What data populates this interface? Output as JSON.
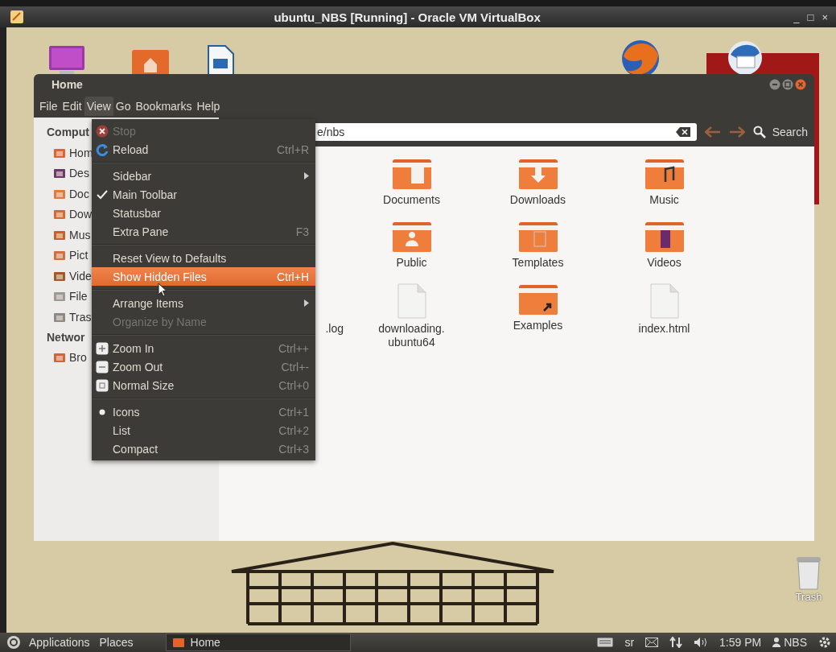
{
  "vm_window": {
    "title": "ubuntu_NBS [Running] - Oracle VM VirtualBox",
    "controls": [
      "_",
      "□",
      "×"
    ]
  },
  "desktop": {
    "trash_label": "Trash"
  },
  "file_manager": {
    "title": "Home",
    "menu_bar": [
      {
        "label": "File",
        "selected": false
      },
      {
        "label": "Edit",
        "selected": false
      },
      {
        "label": "View",
        "selected": true
      },
      {
        "label": "Go",
        "selected": false
      },
      {
        "label": "Bookmarks",
        "selected": false
      },
      {
        "label": "Help",
        "selected": false
      }
    ],
    "sidebar": [
      {
        "heading": "Comput",
        "items": [
          {
            "label": "Hom",
            "kind": "home"
          },
          {
            "label": "Des",
            "kind": "desktop"
          },
          {
            "label": "Doc",
            "kind": "documents"
          },
          {
            "label": "Dow",
            "kind": "downloads"
          },
          {
            "label": "Mus",
            "kind": "music"
          },
          {
            "label": "Pict",
            "kind": "pictures"
          },
          {
            "label": "Vide",
            "kind": "videos"
          },
          {
            "label": "File",
            "kind": "drive"
          },
          {
            "label": "Tras",
            "kind": "trash"
          }
        ]
      },
      {
        "heading": "Networ",
        "items": [
          {
            "label": "Bro",
            "kind": "network"
          }
        ]
      }
    ],
    "location": "e/nbs",
    "search_label": "Search",
    "files": [
      {
        "kind": "none"
      },
      {
        "name": "Documents",
        "kind": "folder-documents"
      },
      {
        "name": "Downloads",
        "kind": "folder-downloads"
      },
      {
        "name": "Music",
        "kind": "folder-music"
      },
      {
        "kind": "none"
      },
      {
        "name": "Public",
        "kind": "folder-public"
      },
      {
        "name": "Templates",
        "kind": "folder-templates"
      },
      {
        "name": "Videos",
        "kind": "folder-videos"
      },
      {
        "name": ".log",
        "kind": "partial"
      },
      {
        "name": "downloading.",
        "name_2": "ubuntu64",
        "kind": "file"
      },
      {
        "name": "Examples",
        "kind": "folder-link"
      },
      {
        "name": "index.html",
        "kind": "file"
      }
    ]
  },
  "view_menu": [
    [
      {
        "label": "Stop",
        "kind": "stop",
        "disabled": true,
        "highlighted": false
      },
      {
        "label": "Reload",
        "shortcut": "Ctrl+R",
        "kind": "reload",
        "disabled": false,
        "highlighted": false
      }
    ],
    [
      {
        "label": "Sidebar",
        "kind": "submenu",
        "disabled": false,
        "highlighted": false
      },
      {
        "label": "Main Toolbar",
        "kind": "check",
        "checked": true,
        "disabled": false,
        "highlighted": false
      },
      {
        "label": "Statusbar",
        "kind": "check",
        "checked": false,
        "disabled": false,
        "highlighted": false
      },
      {
        "label": "Extra Pane",
        "shortcut": "F3",
        "kind": "check",
        "checked": false,
        "disabled": false,
        "highlighted": false
      }
    ],
    [
      {
        "label": "Reset View to Defaults",
        "kind": "plain",
        "disabled": false,
        "highlighted": false
      },
      {
        "label": "Show Hidden Files",
        "shortcut": "Ctrl+H",
        "kind": "check",
        "checked": false,
        "disabled": false,
        "highlighted": true
      }
    ],
    [
      {
        "label": "Arrange Items",
        "kind": "submenu",
        "disabled": false,
        "highlighted": false
      },
      {
        "label": "Organize by Name",
        "kind": "plain",
        "disabled": true,
        "highlighted": false
      }
    ],
    [
      {
        "label": "Zoom In",
        "shortcut": "Ctrl++",
        "kind": "zoom-in",
        "disabled": false,
        "highlighted": false
      },
      {
        "label": "Zoom Out",
        "shortcut": "Ctrl+-",
        "kind": "zoom-out",
        "disabled": false,
        "highlighted": false
      },
      {
        "label": "Normal Size",
        "shortcut": "Ctrl+0",
        "kind": "zoom-normal",
        "disabled": false,
        "highlighted": false
      }
    ],
    [
      {
        "label": "Icons",
        "shortcut": "Ctrl+1",
        "kind": "radio",
        "selected": true,
        "disabled": false,
        "highlighted": false
      },
      {
        "label": "List",
        "shortcut": "Ctrl+2",
        "kind": "radio",
        "selected": false,
        "disabled": false,
        "highlighted": false
      },
      {
        "label": "Compact",
        "shortcut": "Ctrl+3",
        "kind": "radio",
        "selected": false,
        "disabled": false,
        "highlighted": false
      }
    ]
  ],
  "panel": {
    "launchers": [
      "Applications",
      "Places"
    ],
    "task": "Home",
    "keyboard_layout": "sr",
    "clock": "1:59 PM",
    "user": "NBS"
  }
}
